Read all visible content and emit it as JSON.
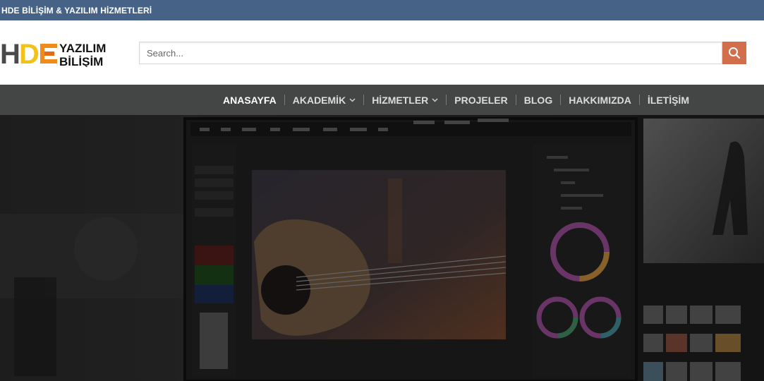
{
  "topbar": {
    "title": "HDE BİLİŞİM & YAZILIM HİZMETLERİ"
  },
  "logo": {
    "mark": "HDE",
    "line1": "YAZILIM",
    "line2": "BİLİŞİM"
  },
  "search": {
    "placeholder": "Search...",
    "value": "",
    "icon": "search-icon"
  },
  "nav": {
    "items": [
      {
        "label": "ANASAYFA",
        "active": true,
        "dropdown": false
      },
      {
        "label": "AKADEMİK",
        "active": false,
        "dropdown": true
      },
      {
        "label": "HİZMETLER",
        "active": false,
        "dropdown": true
      },
      {
        "label": "PROJELER",
        "active": false,
        "dropdown": false
      },
      {
        "label": "BLOG",
        "active": false,
        "dropdown": false
      },
      {
        "label": "HAKKIMIZDA",
        "active": false,
        "dropdown": false
      },
      {
        "label": "İLETİŞİM",
        "active": false,
        "dropdown": false
      }
    ]
  },
  "colors": {
    "topbar": "#466287",
    "accent": "#d26e4b",
    "nav": "#444545"
  }
}
